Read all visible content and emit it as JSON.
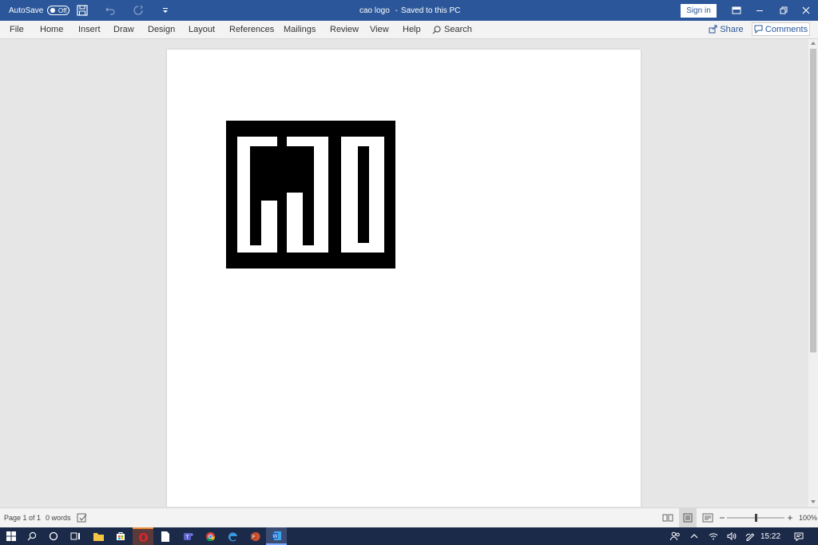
{
  "titlebar": {
    "autosave_label": "AutoSave",
    "autosave_state": "Off",
    "doc_title": "cao logo",
    "save_status": "Saved to this PC",
    "signin_label": "Sign in",
    "bg_color": "#2b579a"
  },
  "ribbon": {
    "tabs": [
      "File",
      "Home",
      "Insert",
      "Draw",
      "Design",
      "Layout",
      "References",
      "Mailings",
      "Review",
      "View",
      "Help"
    ],
    "search_label": "Search",
    "share_label": "Share",
    "comments_label": "Comments"
  },
  "document": {
    "logo_name": "cao logo"
  },
  "statusbar": {
    "page_info": "Page 1 of 1",
    "word_count": "0 words",
    "zoom_level": "100%",
    "zoom_fraction": 0.5
  },
  "taskbar": {
    "clock": "15:22",
    "apps": [
      "start-icon",
      "search-icon",
      "cortana-icon",
      "task-view-icon",
      "file-explorer-icon",
      "store-icon",
      "opera-icon",
      "notepad-icon",
      "teams-icon",
      "chrome-icon",
      "edge-icon",
      "powerpoint-icon",
      "word-icon"
    ]
  }
}
